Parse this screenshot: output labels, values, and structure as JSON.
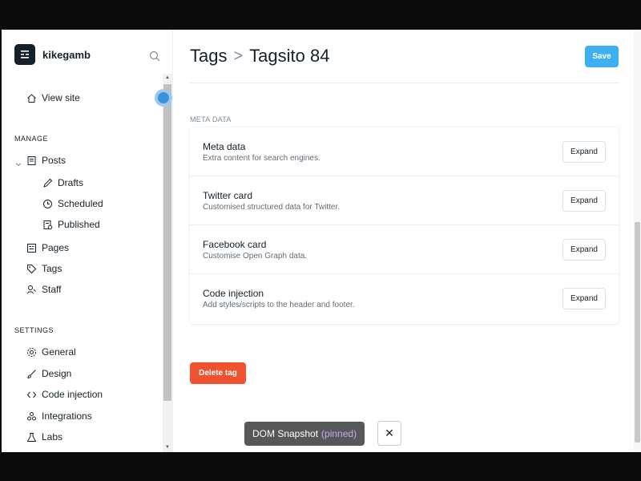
{
  "sidebar": {
    "brand_name": "kikegamb",
    "view_site": "View site",
    "manage_label": "MANAGE",
    "settings_label": "SETTINGS",
    "manage_items": [
      "Posts",
      "Pages",
      "Tags",
      "Staff"
    ],
    "post_sub_items": [
      "Drafts",
      "Scheduled",
      "Published"
    ],
    "settings_items": [
      "General",
      "Design",
      "Code injection",
      "Integrations",
      "Labs"
    ]
  },
  "header": {
    "breadcrumb_parent": "Tags",
    "breadcrumb_separator": ">",
    "breadcrumb_current": "Tagsito 84",
    "save_label": "Save"
  },
  "meta": {
    "section_label": "META DATA",
    "rows": [
      {
        "title": "Meta data",
        "description": "Extra content for search engines.",
        "button": "Expand"
      },
      {
        "title": "Twitter card",
        "description": "Customised structured data for Twitter.",
        "button": "Expand"
      },
      {
        "title": "Facebook card",
        "description": "Customise Open Graph data.",
        "button": "Expand"
      },
      {
        "title": "Code injection",
        "description": "Add styles/scripts to the header and footer.",
        "button": "Expand"
      }
    ]
  },
  "delete_label": "Delete tag",
  "toast": {
    "text": "DOM Snapshot",
    "pinned": "(pinned)",
    "close": "✕"
  },
  "colors": {
    "accent": "#3eb0ef",
    "danger": "#f05230",
    "text": "#15212a"
  }
}
